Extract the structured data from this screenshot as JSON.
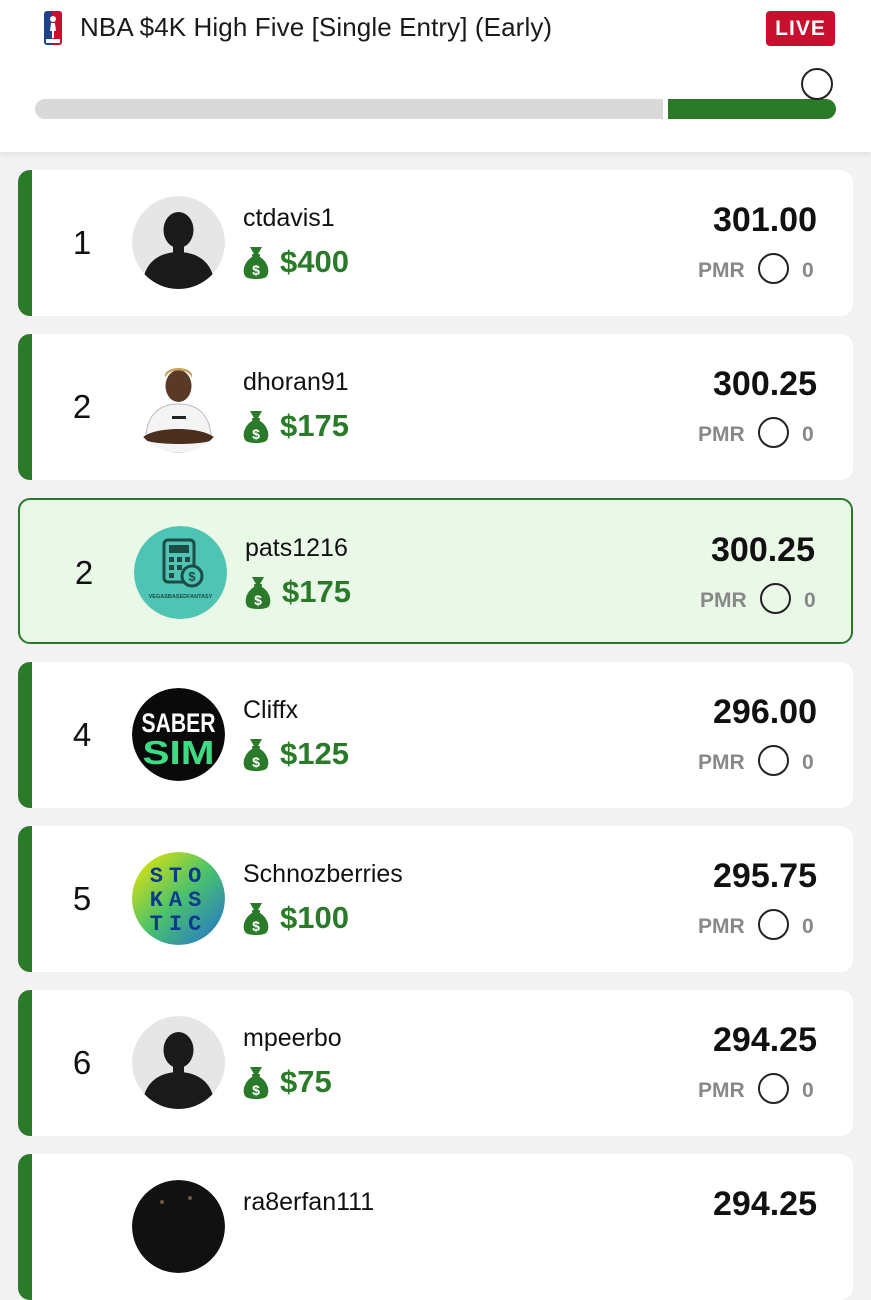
{
  "header": {
    "title": "NBA $4K High Five [Single Entry] (Early)",
    "live_label": "LIVE",
    "progress_fraction": 0.79
  },
  "colors": {
    "accent_green": "#2a7a2a",
    "live_red": "#c8102e",
    "highlight_bg": "#e9f8e7"
  },
  "entries": [
    {
      "rank": "1",
      "username": "ctdavis1",
      "prize": "$400",
      "score": "301.00",
      "pmr_label": "PMR",
      "pmr": "0",
      "avatar": "default-avatar-icon"
    },
    {
      "rank": "2",
      "username": "dhoran91",
      "prize": "$175",
      "score": "300.25",
      "pmr_label": "PMR",
      "pmr": "0",
      "avatar": "player-photo"
    },
    {
      "rank": "2",
      "username": "pats1216",
      "prize": "$175",
      "score": "300.25",
      "pmr_label": "PMR",
      "pmr": "0",
      "avatar": "calculator-logo",
      "highlighted": true
    },
    {
      "rank": "4",
      "username": "Cliffx",
      "prize": "$125",
      "score": "296.00",
      "pmr_label": "PMR",
      "pmr": "0",
      "avatar": "sabersim-logo"
    },
    {
      "rank": "5",
      "username": "Schnozberries",
      "prize": "$100",
      "score": "295.75",
      "pmr_label": "PMR",
      "pmr": "0",
      "avatar": "stokastic-logo"
    },
    {
      "rank": "6",
      "username": "mpeerbo",
      "prize": "$75",
      "score": "294.25",
      "pmr_label": "PMR",
      "pmr": "0",
      "avatar": "default-avatar-icon"
    },
    {
      "rank": "",
      "username": "ra8erfan111",
      "prize": "",
      "score": "294.25",
      "pmr_label": "",
      "pmr": "",
      "avatar": "dark-avatar"
    }
  ],
  "logos": {
    "saber_top": "SABER",
    "saber_bottom": "SIM",
    "stokastic_1": "STO",
    "stokastic_2": "KAS",
    "stokastic_3": "TIC",
    "vegas_text": "VEGASBASEDFANTASY"
  }
}
